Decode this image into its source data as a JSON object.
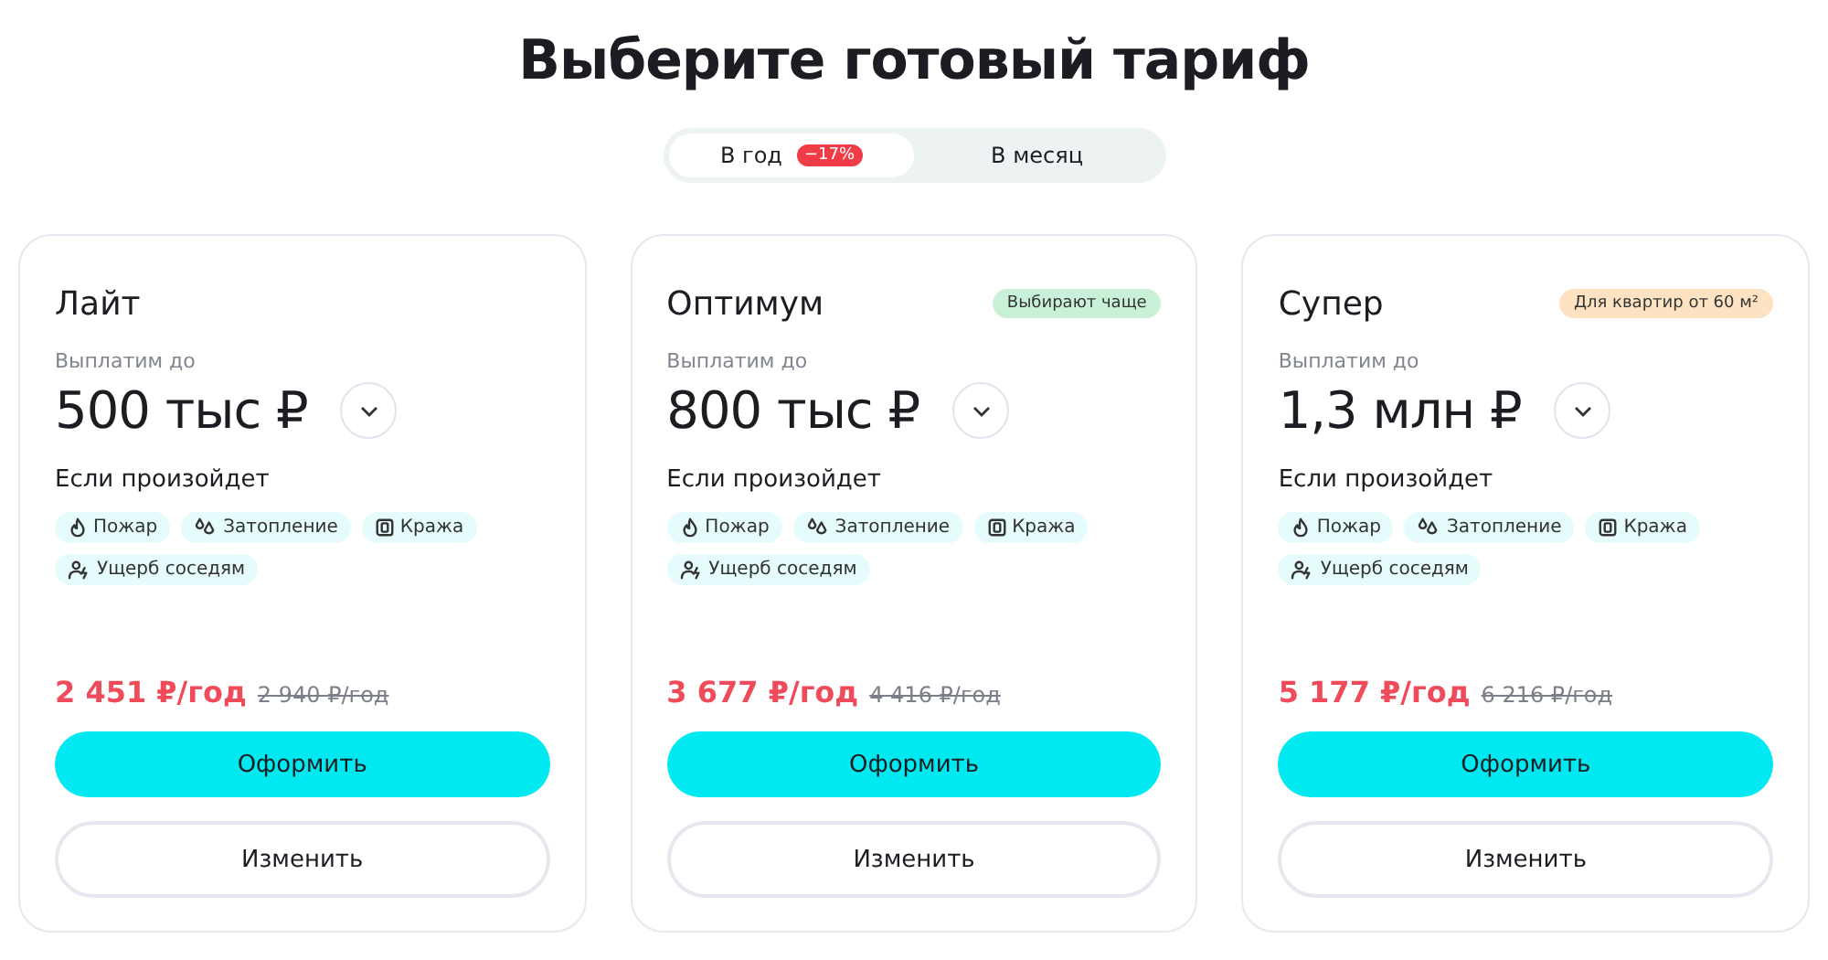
{
  "title": "Выберите готовый тариф",
  "period_tabs": [
    {
      "label": "В год",
      "selected": true,
      "badge": "−17%"
    },
    {
      "label": "В месяц",
      "selected": false
    }
  ],
  "plans": [
    {
      "name": "Лайт",
      "payout_label": "Выплатим до",
      "payout": "500 тыс ₽",
      "events_title": "Если произойдет",
      "events": [
        {
          "kind": "fire",
          "label": "Пожар"
        },
        {
          "kind": "water",
          "label": "Затопление"
        },
        {
          "kind": "theft",
          "label": "Кража"
        },
        {
          "kind": "neighbors",
          "label": "Ущерб соседям"
        }
      ],
      "price": "2 451 ₽/год",
      "old_price": "2 940 ₽/год",
      "buttons": [
        "Оформить",
        "Изменить"
      ]
    },
    {
      "name": "Оптимум",
      "badge": {
        "kind": "popular",
        "label": "Выбирают чаще"
      },
      "payout_label": "Выплатим до",
      "payout": "800 тыс ₽",
      "events_title": "Если произойдет",
      "events": [
        {
          "kind": "fire",
          "label": "Пожар"
        },
        {
          "kind": "water",
          "label": "Затопление"
        },
        {
          "kind": "theft",
          "label": "Кража"
        },
        {
          "kind": "neighbors",
          "label": "Ущерб соседям"
        }
      ],
      "price": "3 677 ₽/год",
      "old_price": "4 416 ₽/год",
      "buttons": [
        "Оформить",
        "Изменить"
      ]
    },
    {
      "name": "Супер",
      "badge": {
        "kind": "condition",
        "label": "Для квартир от 60 м²"
      },
      "payout_label": "Выплатим до",
      "payout": "1,3 млн ₽",
      "events_title": "Если произойдет",
      "events": [
        {
          "kind": "fire",
          "label": "Пожар"
        },
        {
          "kind": "water",
          "label": "Затопление"
        },
        {
          "kind": "theft",
          "label": "Кража"
        },
        {
          "kind": "neighbors",
          "label": "Ущерб соседям"
        }
      ],
      "price": "5 177 ₽/год",
      "old_price": "6 216 ₽/год",
      "buttons": [
        "Оформить",
        "Изменить"
      ]
    }
  ]
}
